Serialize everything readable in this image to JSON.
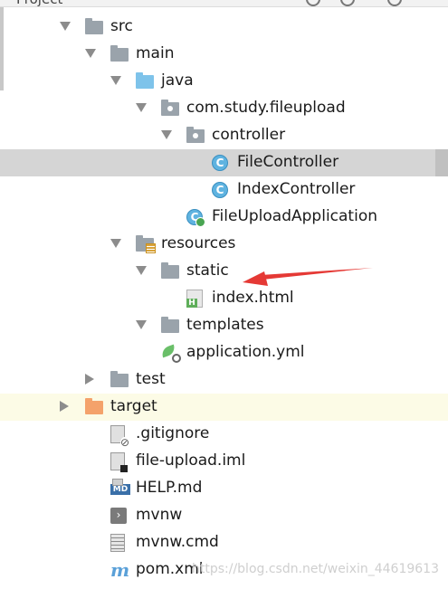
{
  "header": {
    "title": "Project"
  },
  "tree": [
    {
      "name": "src",
      "arrow": "down",
      "icon": "folder"
    },
    {
      "name": "main",
      "arrow": "down",
      "icon": "folder"
    },
    {
      "name": "java",
      "arrow": "down",
      "icon": "folder-blue"
    },
    {
      "name": "com.study.fileupload",
      "arrow": "down",
      "icon": "package"
    },
    {
      "name": "controller",
      "arrow": "down",
      "icon": "package"
    },
    {
      "name": "FileController",
      "arrow": "none",
      "icon": "class",
      "selected": true
    },
    {
      "name": "IndexController",
      "arrow": "none",
      "icon": "class"
    },
    {
      "name": "FileUploadApplication",
      "arrow": "none",
      "icon": "spring-boot-class"
    },
    {
      "name": "resources",
      "arrow": "down",
      "icon": "resources-folder"
    },
    {
      "name": "static",
      "arrow": "down",
      "icon": "folder"
    },
    {
      "name": "index.html",
      "arrow": "none",
      "icon": "html-file"
    },
    {
      "name": "templates",
      "arrow": "down",
      "icon": "folder"
    },
    {
      "name": "application.yml",
      "arrow": "none",
      "icon": "yml-config"
    },
    {
      "name": "test",
      "arrow": "right",
      "icon": "folder"
    },
    {
      "name": "target",
      "arrow": "right",
      "icon": "folder-orange",
      "highlight": true
    },
    {
      "name": ".gitignore",
      "arrow": "none",
      "icon": "gitignore-file"
    },
    {
      "name": "file-upload.iml",
      "arrow": "none",
      "icon": "iml-file"
    },
    {
      "name": "HELP.md",
      "arrow": "none",
      "icon": "markdown-file"
    },
    {
      "name": "mvnw",
      "arrow": "none",
      "icon": "shell-script"
    },
    {
      "name": "mvnw.cmd",
      "arrow": "none",
      "icon": "text-file"
    },
    {
      "name": "pom.xml",
      "arrow": "none",
      "icon": "maven-pom"
    }
  ],
  "annotation": {
    "color": "#e53935",
    "points_to": "static"
  },
  "watermark": "https://blog.csdn.net/weixin_44619613"
}
